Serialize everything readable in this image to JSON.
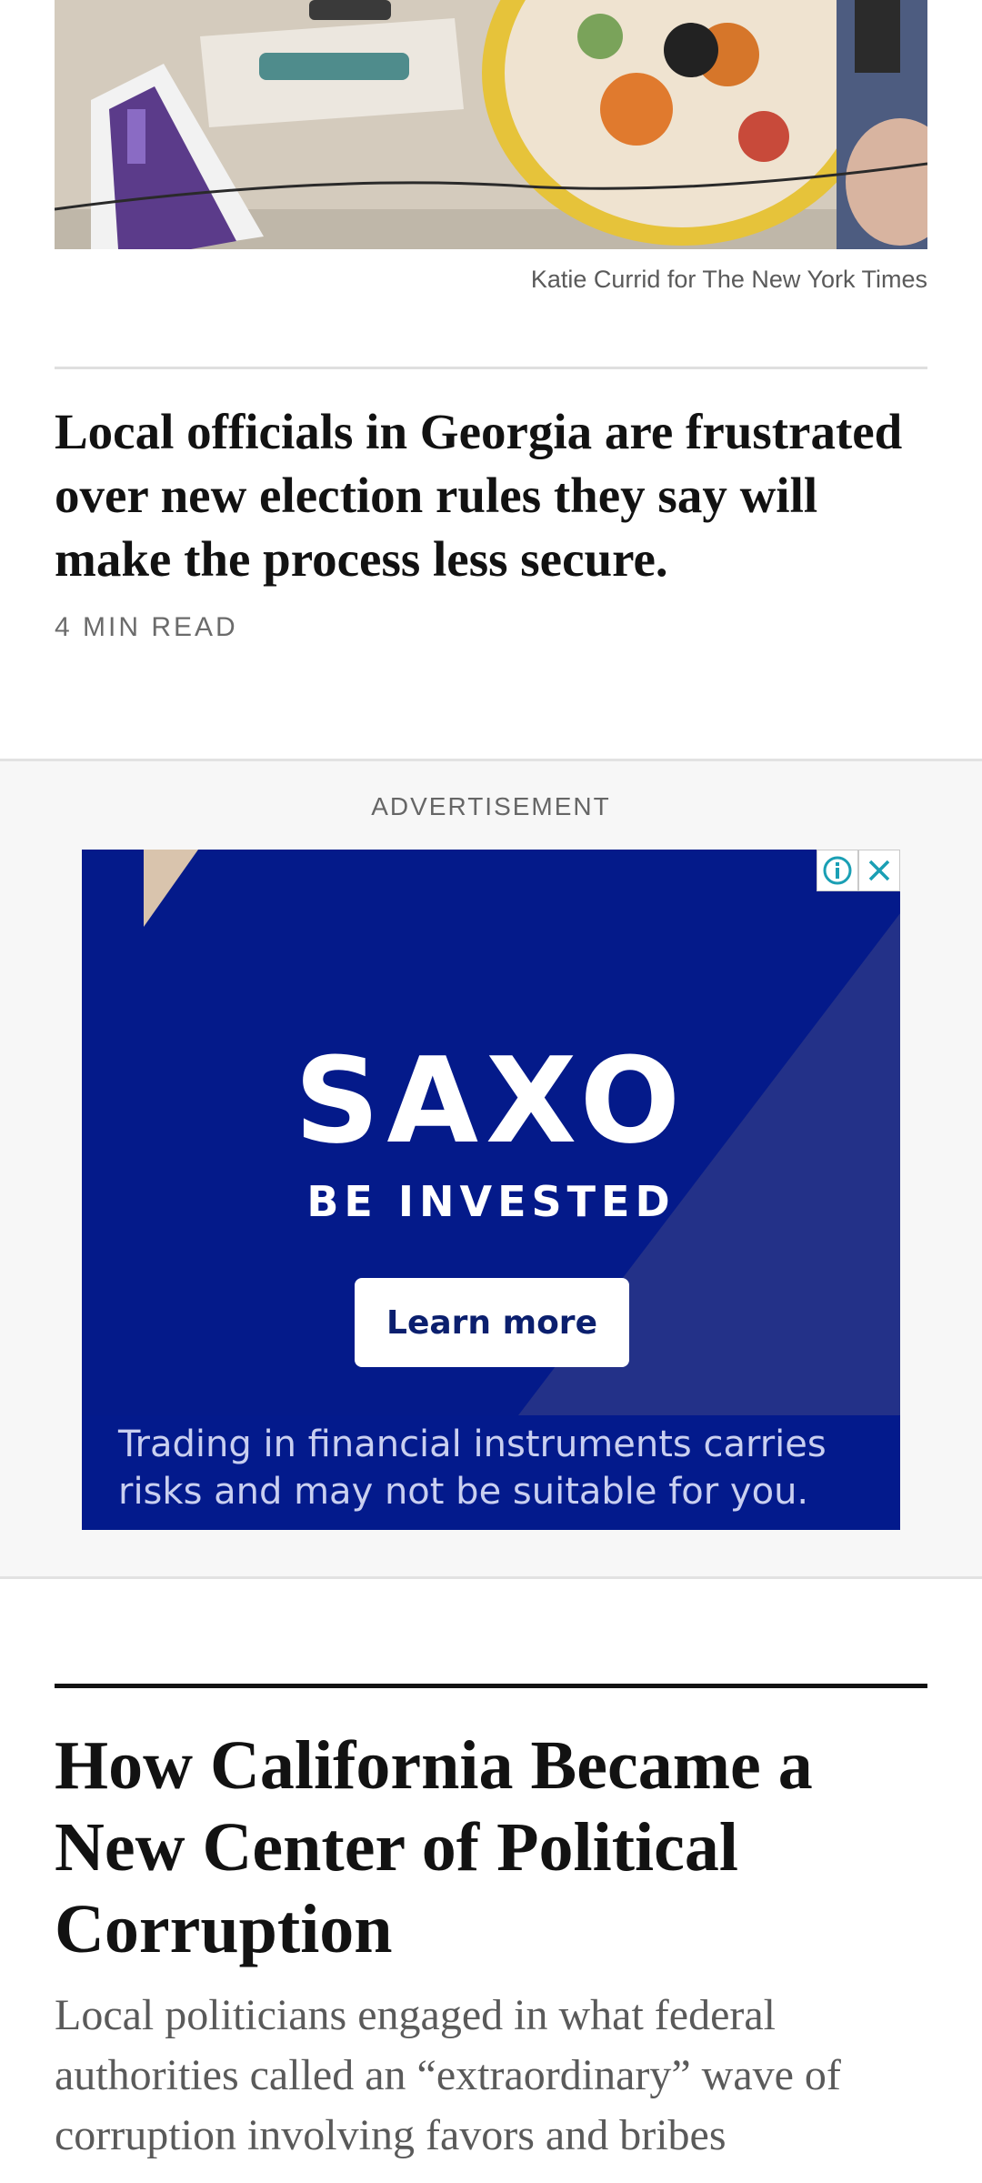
{
  "article1": {
    "photo_credit": "Katie Currid for The New York Times",
    "headline": "Local officials in Georgia are frustrated over new election rules they say will make the process less secure.",
    "read_time": "4 MIN READ"
  },
  "ad": {
    "label": "ADVERTISEMENT",
    "brand": "SAXO",
    "tagline": "BE INVESTED",
    "cta": "Learn more",
    "disclaimer": "Trading in financial instruments carries risks and may not be suitable for you.",
    "icons": [
      "info-icon",
      "close-icon"
    ],
    "colors": {
      "background": "#041a8a",
      "accent": "#233188",
      "button_text": "#0b1f6e"
    }
  },
  "article2": {
    "headline": "How California Became a New Center of Political Corruption",
    "summary": "Local politicians engaged in what federal authorities called an “extraordinary” wave of corruption involving favors and bribes"
  }
}
